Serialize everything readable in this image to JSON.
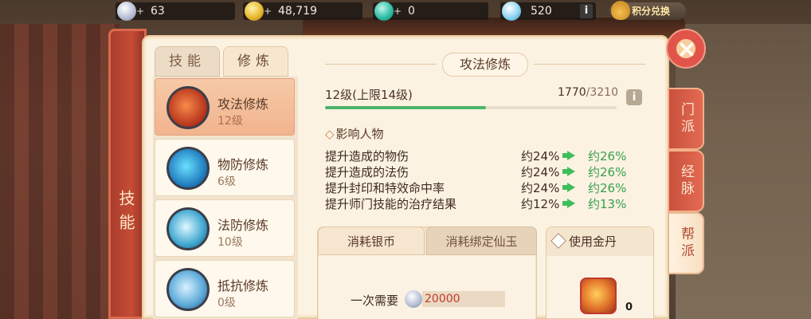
{
  "resources": {
    "silver": {
      "plus": "+",
      "value": "63",
      "icon": "silver-coin-icon"
    },
    "gold": {
      "plus": "+",
      "value": "48,719",
      "icon": "gold-coin-icon"
    },
    "jade": {
      "plus": "+",
      "value": "0",
      "icon": "jade-icon"
    },
    "cloud": {
      "value": "520",
      "icon": "cloud-icon",
      "info": "i"
    },
    "exchange_label": "积分兑换"
  },
  "side_label": "技能",
  "tabs": [
    {
      "label": "技能",
      "active": false
    },
    {
      "label": "修炼",
      "active": true
    }
  ],
  "skills": [
    {
      "name": "攻法修炼",
      "level": "12级",
      "active": true,
      "icon": "attack-sword-icon"
    },
    {
      "name": "物防修炼",
      "level": "6级",
      "active": false,
      "icon": "physical-shield-icon"
    },
    {
      "name": "法防修炼",
      "level": "10级",
      "active": false,
      "icon": "magic-orb-icon"
    },
    {
      "name": "抵抗修炼",
      "level": "0级",
      "active": false,
      "icon": "resist-armor-icon"
    }
  ],
  "detail": {
    "title": "攻法修炼",
    "level_text": "12级(上限14级)",
    "exp_current": "1770",
    "exp_sep_max": "/3210",
    "exp_progress": 0.551,
    "info_icon": "i",
    "affect_marker": "◇",
    "affect_title": "影响人物",
    "effects": [
      {
        "label": "提升造成的物伤",
        "current": "约24%",
        "next": "约26%"
      },
      {
        "label": "提升造成的法伤",
        "current": "约24%",
        "next": "约26%"
      },
      {
        "label": "提升封印和特效命中率",
        "current": "约24%",
        "next": "约26%"
      },
      {
        "label": "提升师门技能的治疗结果",
        "current": "约12%",
        "next": "约13%"
      }
    ]
  },
  "cost": {
    "tab_silver": "消耗银币",
    "tab_bound": "消耗绑定仙玉",
    "need_label": "一次需要",
    "need_value": "20000",
    "use_pill_label": "使用金丹",
    "pill_count": "0"
  },
  "side_tabs": [
    {
      "label": "门派",
      "active": false
    },
    {
      "label": "经脉",
      "active": false
    },
    {
      "label": "帮派",
      "active": true
    }
  ],
  "colors": {
    "accent_red": "#c9503c",
    "panel_bg": "#fbf2e2",
    "progress_green": "#4db36b",
    "cost_red": "#c23a2a"
  }
}
